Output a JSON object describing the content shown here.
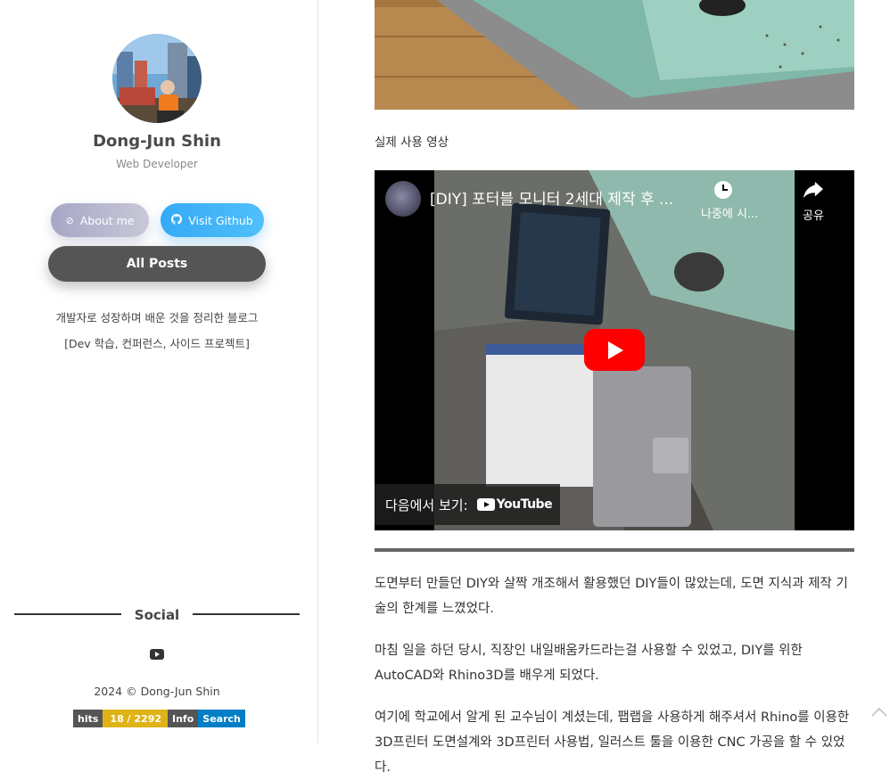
{
  "profile": {
    "name": "Dong-Jun Shin",
    "role": "Web Developer"
  },
  "buttons": {
    "about": "About me",
    "github": "Visit Github",
    "posts": "All Posts"
  },
  "description": {
    "line1": "개발자로 성장하며 배운 것을 정리한 블로그",
    "line2": "[Dev 학습, 컨퍼런스, 사이드 프로젝트]"
  },
  "social": {
    "title": "Social",
    "icons": [
      "youtube-icon"
    ]
  },
  "footer": {
    "copyright": "2024 © Dong-Jun Shin",
    "hits_label": "hits",
    "hits_value": "18 / 2292",
    "info_label": "Info",
    "info_value": "Search"
  },
  "post": {
    "caption": "실제 사용 영상",
    "video": {
      "title": "[DIY] 포터블 모니터 2세대 제작 후 ...",
      "watch_later": "나중에 시...",
      "share": "공유",
      "watch_on": "다음에서 보기:",
      "brand": "YouTube"
    },
    "paragraphs": [
      "도면부터 만들던 DIY와 살짝 개조해서 활용했던 DIY들이 많았는데, 도면 지식과 제작 기술의 한계를 느꼈었다.",
      "마침 일을 하던 당시, 직장인 내일배움카드라는걸 사용할 수 있었고, DIY를 위한 AutoCAD와 Rhino3D를 배우게 되었다.",
      "여기에 학교에서 알게 된 교수님이 계셨는데, 팹랩을 사용하게 해주셔서 Rhino를 이용한 3D프린터 도면설계와 3D프린터 사용법, 일러스트 툴을 이용한 CNC 가공을 할 수 있었다."
    ]
  },
  "colors": {
    "about_btn": "#b7b6cf",
    "github_btn": "#3eb2f7",
    "posts_btn": "#555555",
    "youtube_red": "#ff0000"
  }
}
